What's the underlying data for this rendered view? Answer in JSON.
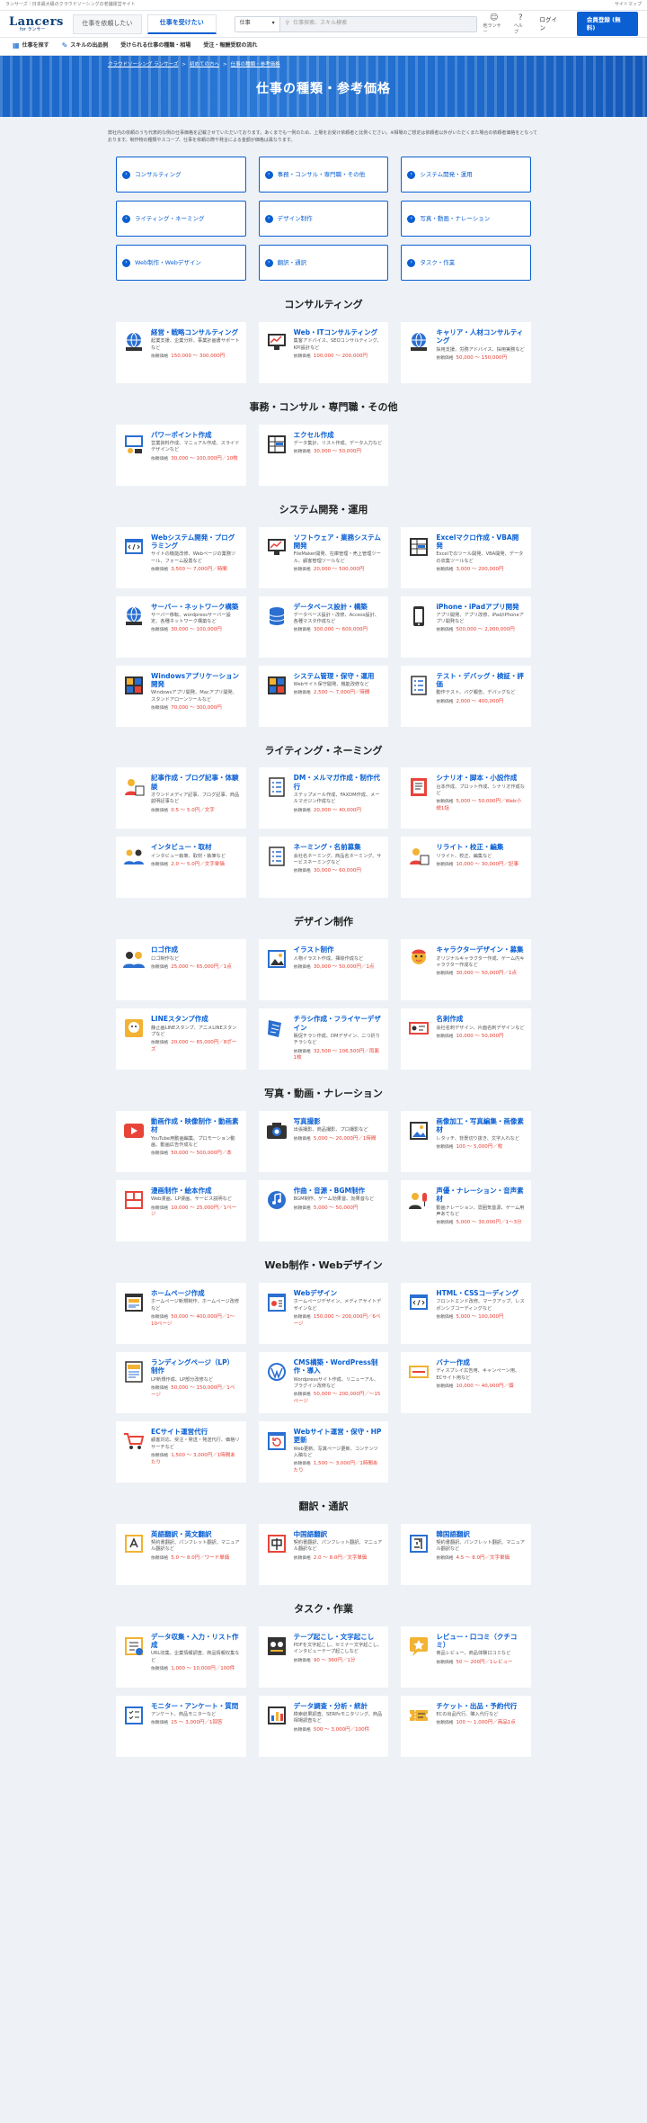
{
  "topbar": {
    "left": "ランサーズ｜日本最大級のクラウドソーシングの老舗運営サイト",
    "right": "サイトマップ"
  },
  "header": {
    "logo_main": "Lancers",
    "logo_sub": "for ランサー",
    "tab_client": "仕事を依頼したい",
    "tab_worker": "仕事を受けたい",
    "search_select": "仕事",
    "search_placeholder": "仕事探索、スキル検索",
    "icon_lancer": "他ランサー",
    "icon_help": "ヘルプ",
    "login": "ログイン",
    "signup": "会員登録 (無料)"
  },
  "subnav": [
    "仕事を探す",
    "スキルの出品例",
    "受けられる仕事の種類・相場",
    "受注・報酬受取の流れ"
  ],
  "hero": {
    "crumbs": [
      "クラウドソーシング ランサーズ",
      "初めての方へ",
      "仕事の種類・参考価格"
    ],
    "title": "仕事の種類・参考価格"
  },
  "intro": "弊社内の依頼のうち代表的な例の仕事価格を記載させていただいております。あくまでも一例のため、上場をお受け依頼者と比例ください。※相場のご想定は依頼者以外がいただくまた場合の依頼者価格をとなっております。制作物の種類やスコープ、仕事を依頼の際や発言による金額が価格は異なります。",
  "categories": [
    "コンサルティング",
    "事務・コンサル・専門職・その他",
    "システム開発・運用",
    "ライティング・ネーミング",
    "デザイン制作",
    "写真・動画・ナレーション",
    "Web制作・Webデザイン",
    "翻訳・通訳",
    "タスク・作業"
  ],
  "price_label": "依頼価格",
  "sections": [
    {
      "title": "コンサルティング",
      "cards": [
        {
          "icon": "globe-network-icon",
          "title": "経営・戦略コンサルティング",
          "desc": "起業支援、企業分析、事業計画書サポートなど",
          "price": "150,000 〜 300,000円"
        },
        {
          "icon": "monitor-chart-icon",
          "title": "Web・ITコンサルティング",
          "desc": "集客アドバイス、SEOコンサルティング、KPI設計など",
          "price": "100,000 〜 200,000円"
        },
        {
          "icon": "globe-network-icon",
          "title": "キャリア・人材コンサルティング",
          "desc": "採用支援、労務アドバイス、採用実務など",
          "price": "50,000 〜 150,000円"
        }
      ]
    },
    {
      "title": "事務・コンサル・専門職・その他",
      "cards": [
        {
          "icon": "presentation-icon",
          "title": "パワーポイント作成",
          "desc": "営業資料作成、マニュアル作成、スライドデザインなど",
          "price": "30,000 〜 100,000円／10枚"
        },
        {
          "icon": "spreadsheet-icon",
          "title": "エクセル作成",
          "desc": "データ集計、リスト作成、データ入力など",
          "price": "30,000 〜 50,000円"
        }
      ]
    },
    {
      "title": "システム開発・運用",
      "cards": [
        {
          "icon": "code-window-icon",
          "title": "Webシステム開発・プログラミング",
          "desc": "サイトの機能改修、Webページの業務ツール、フォーム設置など",
          "price": "3,500 〜 7,000円／時間"
        },
        {
          "icon": "monitor-chart-icon",
          "title": "ソフトウェア・業務システム開発",
          "desc": "FileMaker開発、在庫管理・売上管理ツール、顧客管理ツールなど",
          "price": "20,000 〜 500,000円"
        },
        {
          "icon": "spreadsheet-icon",
          "title": "Excelマクロ作成・VBA開発",
          "desc": "Excelでのツール開発、VBA開発、データの収集ツールなど",
          "price": "3,000 〜 200,000円"
        },
        {
          "icon": "globe-network-icon",
          "title": "サーバー・ネットワーク構築",
          "desc": "サーバー移転、wordpressサーバー設定、各種ネットワーク構築など",
          "price": "30,000 〜 100,000円"
        },
        {
          "icon": "database-icon",
          "title": "データベース設計・構築",
          "desc": "データベース設計・改修、Access設計、各種マスタ作成など",
          "price": "300,000 〜 600,000円"
        },
        {
          "icon": "smartphone-icon",
          "title": "iPhone・iPadアプリ開発",
          "desc": "アプリ開発、アプリ改修、iPad/iPhoneアプリ開発など",
          "price": "500,000 〜 2,000,000円"
        },
        {
          "icon": "app-grid-icon",
          "title": "Windowsアプリケーション開発",
          "desc": "Windowsアプリ開発、Macアプリ開発、スタンドアローンツールなど",
          "price": "70,000 〜 300,000円"
        },
        {
          "icon": "app-grid-icon",
          "title": "システム管理・保守・運用",
          "desc": "Webサイト保守開発、機能改修など",
          "price": "2,500 〜 7,000円／時間"
        },
        {
          "icon": "checklist-icon",
          "title": "テスト・デバッグ・検証・評価",
          "desc": "動作テスト、バグ報告、デバッグなど",
          "price": "2,000 〜 400,000円"
        }
      ]
    },
    {
      "title": "ライティング・ネーミング",
      "cards": [
        {
          "icon": "writer-icon",
          "title": "記事作成・ブログ記事・体験談",
          "desc": "オウンドメディア記事、ブログ記事、商品説明記事など",
          "price": "0.5 〜 5.0円／文字"
        },
        {
          "icon": "checklist-icon",
          "title": "DM・メルマガ作成・制作代行",
          "desc": "ステップメール作成、FAXDM作成、メールマガジン作成など",
          "price": "20,000 〜 40,000円"
        },
        {
          "icon": "book-icon",
          "title": "シナリオ・脚本・小説作成",
          "desc": "台本作成、プロット作成、シナリオ作成など",
          "price": "5,000 〜 50,000円／Web小説1話"
        },
        {
          "icon": "interview-icon",
          "title": "インタビュー・取材",
          "desc": "インタビュー執筆、取材・執筆など",
          "price": "2.0 〜 5.0円／文字単価"
        },
        {
          "icon": "checklist-icon",
          "title": "ネーミング・名前募集",
          "desc": "会社名ネーミング、商品名ネーミング、サービスネーミングなど",
          "price": "30,000 〜 60,000円"
        },
        {
          "icon": "writer-icon",
          "title": "リライト・校正・編集",
          "desc": "リライト、校正、編集など",
          "price": "10,000 〜 30,000円／記事"
        }
      ]
    },
    {
      "title": "デザイン制作",
      "cards": [
        {
          "icon": "logo-people-icon",
          "title": "ロゴ作成",
          "desc": "ロゴ制作など",
          "price": "25,000 〜 65,000円／1点"
        },
        {
          "icon": "illustration-icon",
          "title": "イラスト制作",
          "desc": "人物イラスト作成、挿絵作成など",
          "price": "30,000 〜 50,000円／1点"
        },
        {
          "icon": "character-icon",
          "title": "キャラクターデザイン・募集",
          "desc": "オリジナルキャラクター作成、ゲーム内キャラクター作成など",
          "price": "30,000 〜 50,000円／1点"
        },
        {
          "icon": "line-stamp-icon",
          "title": "LINEスタンプ作成",
          "desc": "静止画LINEスタンプ、アニメLINEスタンプなど",
          "price": "20,000 〜 65,000円／8ポーズ"
        },
        {
          "icon": "flyer-icon",
          "title": "チラシ作成・フライヤーデザイン",
          "desc": "販促チラシ作成、DMデザイン、ニつ折りチラシなど",
          "price": "32,500 〜 106,500円／両面1枚"
        },
        {
          "icon": "business-card-icon",
          "title": "名刺作成",
          "desc": "会社名刺デザイン、片面名刺デザインなど",
          "price": "10,000 〜 50,000円"
        }
      ]
    },
    {
      "title": "写真・動画・ナレーション",
      "cards": [
        {
          "icon": "video-play-icon",
          "title": "動画作成・映像制作・動画素材",
          "desc": "YouTube用動画編集、プロモーション動画、動画広告作成など",
          "price": "50,000 〜 500,000円／本"
        },
        {
          "icon": "camera-icon",
          "title": "写真撮影",
          "desc": "出張撮影、商品撮影、プロ撮影など",
          "price": "5,000 〜 20,000円／1時間"
        },
        {
          "icon": "image-edit-icon",
          "title": "画像加工・写真編集・画像素材",
          "desc": "レタッチ、背景切り抜き、文字入れなど",
          "price": "100 〜 5,000円／枚"
        },
        {
          "icon": "comic-book-icon",
          "title": "漫画制作・絵本作成",
          "desc": "Web漫画、LP漫画、サービス説明など",
          "price": "10,000 〜 25,000円／1ページ"
        },
        {
          "icon": "music-note-icon",
          "title": "作曲・音源・BGM制作",
          "desc": "BGM制作、ゲーム効果音、効果音など",
          "price": "5,000 〜 50,000円"
        },
        {
          "icon": "microphone-icon",
          "title": "声優・ナレーション・音声素材",
          "desc": "動画ナレーション、雰囲気音源、ゲーム用声あてなど",
          "price": "5,000 〜 30,000円／1〜3分"
        }
      ]
    },
    {
      "title": "Web制作・Webデザイン",
      "cards": [
        {
          "icon": "webpage-icon",
          "title": "ホームページ作成",
          "desc": "ホームページ新規制作、ホームページ改修など",
          "price": "50,000 〜 400,000円／1〜10ページ"
        },
        {
          "icon": "web-design-icon",
          "title": "Webデザイン",
          "desc": "ホームページデザイン、メディアサイトデザインなど",
          "price": "150,000 〜 200,000円／6ページ"
        },
        {
          "icon": "code-window-icon",
          "title": "HTML・CSSコーディング",
          "desc": "フロントエンド改修、マークアップ、レスポンシブコーディングなど",
          "price": "5,000 〜 100,000円"
        },
        {
          "icon": "landing-page-icon",
          "title": "ランディングページ（LP）制作",
          "desc": "LP新規作成、LP部分改修など",
          "price": "50,000 〜 150,000円／1ページ"
        },
        {
          "icon": "wordpress-icon",
          "title": "CMS構築・WordPress制作・導入",
          "desc": "Wordpressサイト作成、リニューアル、プラグイン改修など",
          "price": "50,000 〜 200,000円／〜15ページ"
        },
        {
          "icon": "banner-icon",
          "title": "バナー作成",
          "desc": "ディスプレイ広告用、キャンペーン用、ECサイト用など",
          "price": "10,000 〜 40,000円／個"
        },
        {
          "icon": "shopping-cart-icon",
          "title": "ECサイト運営代行",
          "desc": "顧客対応、受注・発送・発送代行、価格リサーチなど",
          "price": "1,500 〜 3,000円／1時間あたり"
        },
        {
          "icon": "web-update-icon",
          "title": "Webサイト運営・保守・HP更新",
          "desc": "Web更新、写真ページ更新、コンテンツ入稿など",
          "price": "1,500 〜 3,000円／1時間あたり"
        }
      ]
    },
    {
      "title": "翻訳・通訳",
      "cards": [
        {
          "icon": "english-translation-icon",
          "title": "英語翻訳・英文翻訳",
          "desc": "契約書翻訳、パンフレット翻訳、マニュアル翻訳など",
          "price": "5.0 〜 8.0円／ワード単価"
        },
        {
          "icon": "chinese-translation-icon",
          "title": "中国語翻訳",
          "desc": "契約書翻訳、パンフレット翻訳、マニュアル翻訳など",
          "price": "2.0 〜 8.0円／文字単価"
        },
        {
          "icon": "korean-translation-icon",
          "title": "韓国語翻訳",
          "desc": "契約書翻訳、パンフレット翻訳、マニュアル翻訳など",
          "price": "4.5 〜 8.0円／文字単価"
        }
      ]
    },
    {
      "title": "タスク・作業",
      "cards": [
        {
          "icon": "data-entry-icon",
          "title": "データ収集・入力・リスト作成",
          "desc": "URL収集、企業情報調査、商品情報収集など",
          "price": "1,000 〜 10,000円／100件"
        },
        {
          "icon": "transcription-icon",
          "title": "テープ起こし・文字起こし",
          "desc": "PDFを文字起こし、セミナー文字起こし、インタビューテープ起こしなど",
          "price": "90 〜 360円／1分"
        },
        {
          "icon": "review-icon",
          "title": "レビュー・口コミ（クチコミ）",
          "desc": "商品レビュー、商品体験口コミなど",
          "price": "50 〜 200円／1レビュー"
        },
        {
          "icon": "survey-icon",
          "title": "モニター・アンケート・質問",
          "desc": "アンケート、商品モニターなど",
          "price": "15 〜 3,000円／1回答"
        },
        {
          "icon": "data-analysis-icon",
          "title": "データ調査・分析・統計",
          "desc": "検索結果調査、SERPsモニタリング、商品相場調査など",
          "price": "500 〜 3,000円／100件"
        },
        {
          "icon": "ticket-icon",
          "title": "チケット・出品・予約代行",
          "desc": "ECの出品代行、購入代行など",
          "price": "100 〜 1,000円／商品1点"
        }
      ]
    }
  ]
}
